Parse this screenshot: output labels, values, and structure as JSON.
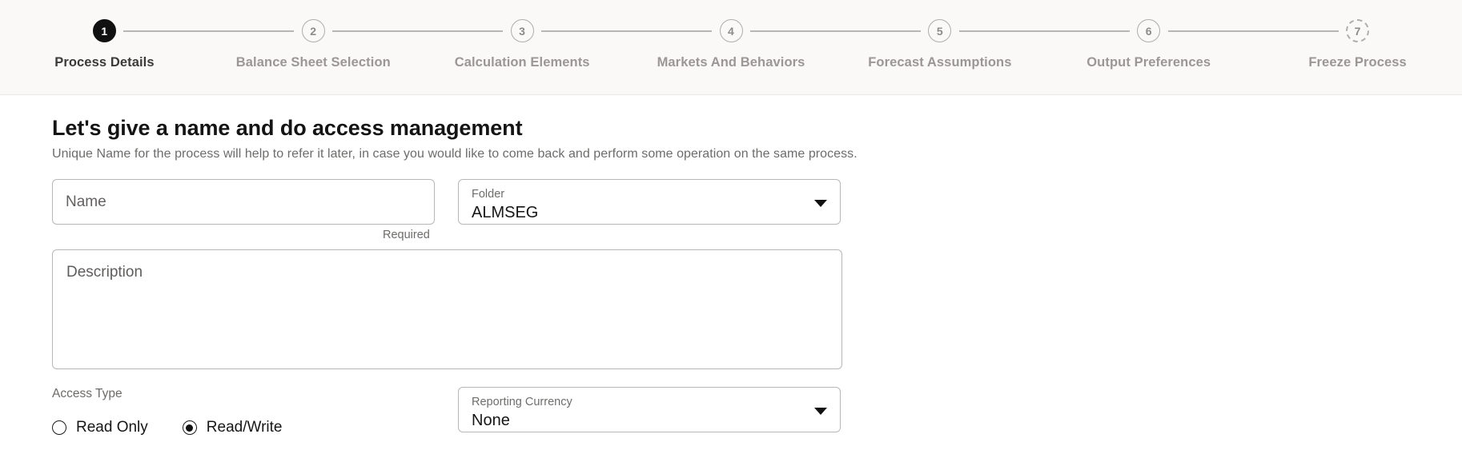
{
  "stepper": {
    "steps": [
      {
        "number": "1",
        "label": "Process Details",
        "state": "active"
      },
      {
        "number": "2",
        "label": "Balance Sheet Selection",
        "state": "pending"
      },
      {
        "number": "3",
        "label": "Calculation Elements",
        "state": "pending"
      },
      {
        "number": "4",
        "label": "Markets And Behaviors",
        "state": "pending"
      },
      {
        "number": "5",
        "label": "Forecast Assumptions",
        "state": "pending"
      },
      {
        "number": "6",
        "label": "Output Preferences",
        "state": "pending"
      },
      {
        "number": "7",
        "label": "Freeze Process",
        "state": "dashed"
      }
    ],
    "active_color": "#111111",
    "pending_color": "#9a9794",
    "line_color": "#b8b6b3",
    "bar_background": "#faf9f7"
  },
  "main": {
    "title": "Let's give a name and do access management",
    "subtitle": "Unique Name for the process will help to refer it later, in case you would like to come back and perform some operation on the same process.",
    "name": {
      "placeholder": "Name",
      "value": "",
      "helper_text": "Required"
    },
    "folder": {
      "label": "Folder",
      "value": "ALMSEG"
    },
    "description": {
      "placeholder": "Description",
      "value": ""
    },
    "access_type": {
      "label": "Access Type",
      "options": [
        {
          "label": "Read Only",
          "selected": false
        },
        {
          "label": "Read/Write",
          "selected": true
        }
      ]
    },
    "reporting_currency": {
      "label": "Reporting Currency",
      "value": "None"
    }
  }
}
